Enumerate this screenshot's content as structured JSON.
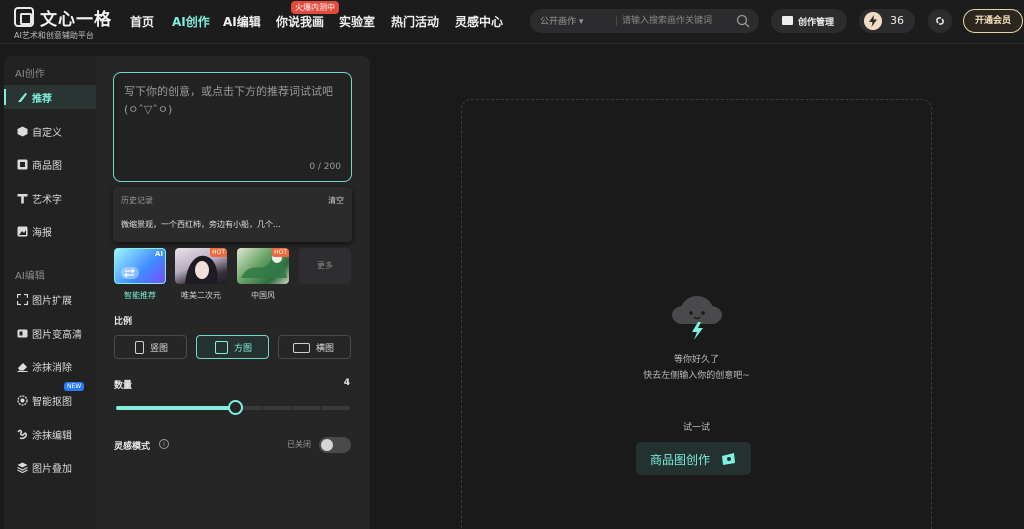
{
  "brand": {
    "name": "文心一格",
    "tagline": "AI艺术和创意辅助平台"
  },
  "nav": {
    "items": [
      "首页",
      "AI创作",
      "AI编辑",
      "你说我画",
      "实验室",
      "热门活动",
      "灵感中心"
    ],
    "hot_badge": "火爆内测中",
    "active": "AI创作"
  },
  "search": {
    "scope": "公开画作 ▾",
    "placeholder": "请输入搜索画作关键词"
  },
  "header": {
    "manage_label": "创作管理",
    "credits": "36",
    "vip_label": "开通会员"
  },
  "sidebar": {
    "group1": "AI创作",
    "items1": [
      {
        "label": "推荐",
        "icon": "brush-icon"
      },
      {
        "label": "自定义",
        "icon": "cube-icon"
      },
      {
        "label": "商品图",
        "icon": "product-image-icon"
      },
      {
        "label": "艺术字",
        "icon": "art-text-icon"
      },
      {
        "label": "海报",
        "icon": "poster-icon"
      }
    ],
    "group2": "AI编辑",
    "items2": [
      {
        "label": "图片扩展",
        "icon": "expand-icon"
      },
      {
        "label": "图片变高清",
        "icon": "hd-icon"
      },
      {
        "label": "涂抹消除",
        "icon": "eraser-icon"
      },
      {
        "label": "智能抠图",
        "icon": "cutout-icon",
        "badge": "NEW"
      },
      {
        "label": "涂抹编辑",
        "icon": "smear-edit-icon"
      },
      {
        "label": "图片叠加",
        "icon": "layers-icon"
      }
    ]
  },
  "prompt": {
    "placeholder": "写下你的创意，或点击下方的推荐词试试吧(ㅇˆ▽ˆㅇ)",
    "count": "0 / 200"
  },
  "history": {
    "title": "历史记录",
    "clear_label": "清空",
    "entries": [
      "微缩景观，一个西红柿，旁边有小船，几个..."
    ]
  },
  "styles": {
    "items": [
      {
        "label": "智能推荐",
        "tag": "AI",
        "active": true
      },
      {
        "label": "唯美二次元",
        "tag": "HOT"
      },
      {
        "label": "中国风",
        "tag": "HOT"
      }
    ],
    "more_label": "更多"
  },
  "ratio": {
    "label": "比例",
    "options": [
      "竖图",
      "方图",
      "横图"
    ],
    "selected": "方图"
  },
  "quantity": {
    "label": "数量",
    "value": "4",
    "max": 6
  },
  "inspiration": {
    "label": "灵感模式",
    "info": "i",
    "status": "已关闭",
    "enabled": false
  },
  "canvas": {
    "empty_line1": "等你好久了",
    "empty_line2": "快去左侧输入你的创意吧~",
    "try_label": "试一试",
    "try_button": "商品图创作"
  },
  "colors": {
    "accent": "#7ff0dd",
    "hot": "#e24a3b",
    "vip": "#e9d4a6"
  }
}
